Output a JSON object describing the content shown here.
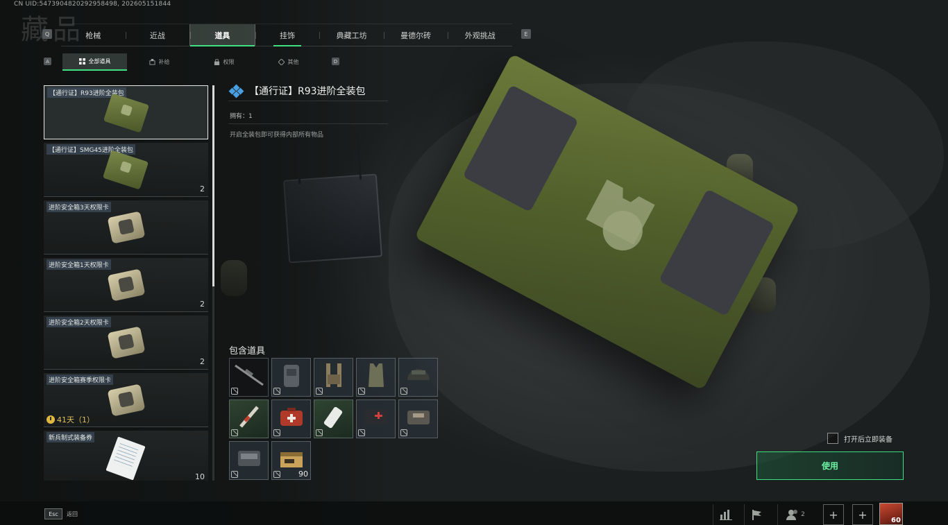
{
  "meta": {
    "uid": "CN UID:5473904820292958498, 202605151844",
    "page_title": "藏品"
  },
  "main_tabs": {
    "left_key": "Q",
    "right_key": "E",
    "items": [
      {
        "label": "枪械"
      },
      {
        "label": "近战"
      },
      {
        "label": "道具"
      },
      {
        "label": "挂饰"
      },
      {
        "label": "典藏工坊"
      },
      {
        "label": "曼德尔砖"
      },
      {
        "label": "外观挑战"
      }
    ],
    "active_index": 2
  },
  "sub_tabs": {
    "left_key": "A",
    "right_key": "D",
    "items": [
      {
        "label": "全部道具",
        "icon": "grid-icon"
      },
      {
        "label": "补给",
        "icon": "supply-icon"
      },
      {
        "label": "权限",
        "icon": "permission-icon"
      },
      {
        "label": "其他",
        "icon": "other-icon"
      }
    ],
    "active_index": 0
  },
  "items": [
    {
      "name": "【通行证】R93进阶全装包",
      "count": "",
      "thumb": "box",
      "selected": true
    },
    {
      "name": "【通行证】SMG45进阶全装包",
      "count": "2",
      "thumb": "box"
    },
    {
      "name": "进阶安全箱3天权限卡",
      "count": "",
      "thumb": "safe"
    },
    {
      "name": "进阶安全箱1天权限卡",
      "count": "2",
      "thumb": "safe"
    },
    {
      "name": "进阶安全箱2天权限卡",
      "count": "2",
      "thumb": "safe"
    },
    {
      "name": "进阶安全箱赛季权限卡",
      "count": "",
      "thumb": "safe",
      "timer": "41天（1）"
    },
    {
      "name": "新兵制式装备券",
      "count": "10",
      "thumb": "paper"
    }
  ],
  "detail": {
    "title": "【通行证】R93进阶全装包",
    "owned": "拥有：1",
    "description": "开启全装包即可获得内部所有物品",
    "contents_label": "包含道具",
    "contents": [
      {
        "icon": "sniper-rifle-icon",
        "tier": "dark",
        "qty": ""
      },
      {
        "icon": "backpack-icon",
        "tier": "blue",
        "qty": ""
      },
      {
        "icon": "chest-rig-icon",
        "tier": "blue",
        "qty": ""
      },
      {
        "icon": "armor-vest-icon",
        "tier": "blue",
        "qty": ""
      },
      {
        "icon": "helmet-icon",
        "tier": "blue",
        "qty": ""
      },
      {
        "icon": "injector-icon",
        "tier": "green",
        "qty": ""
      },
      {
        "icon": "medkit-icon",
        "tier": "blue",
        "qty": ""
      },
      {
        "icon": "pill-bottle-icon",
        "tier": "green",
        "qty": ""
      },
      {
        "icon": "first-aid-icon",
        "tier": "blue",
        "qty": ""
      },
      {
        "icon": "repair-kit-icon",
        "tier": "blue",
        "qty": ""
      },
      {
        "icon": "armor-repair-icon",
        "tier": "blue",
        "qty": ""
      },
      {
        "icon": "ammo-box-icon",
        "tier": "blue",
        "qty": "90"
      }
    ]
  },
  "actions": {
    "equip_on_open": "打开后立即装备",
    "use_button": "使用",
    "accent_color": "#3fe07f"
  },
  "bottom_bar": {
    "esc_key": "Esc",
    "back_label": "返回",
    "squad_count": "2",
    "level": "60"
  }
}
